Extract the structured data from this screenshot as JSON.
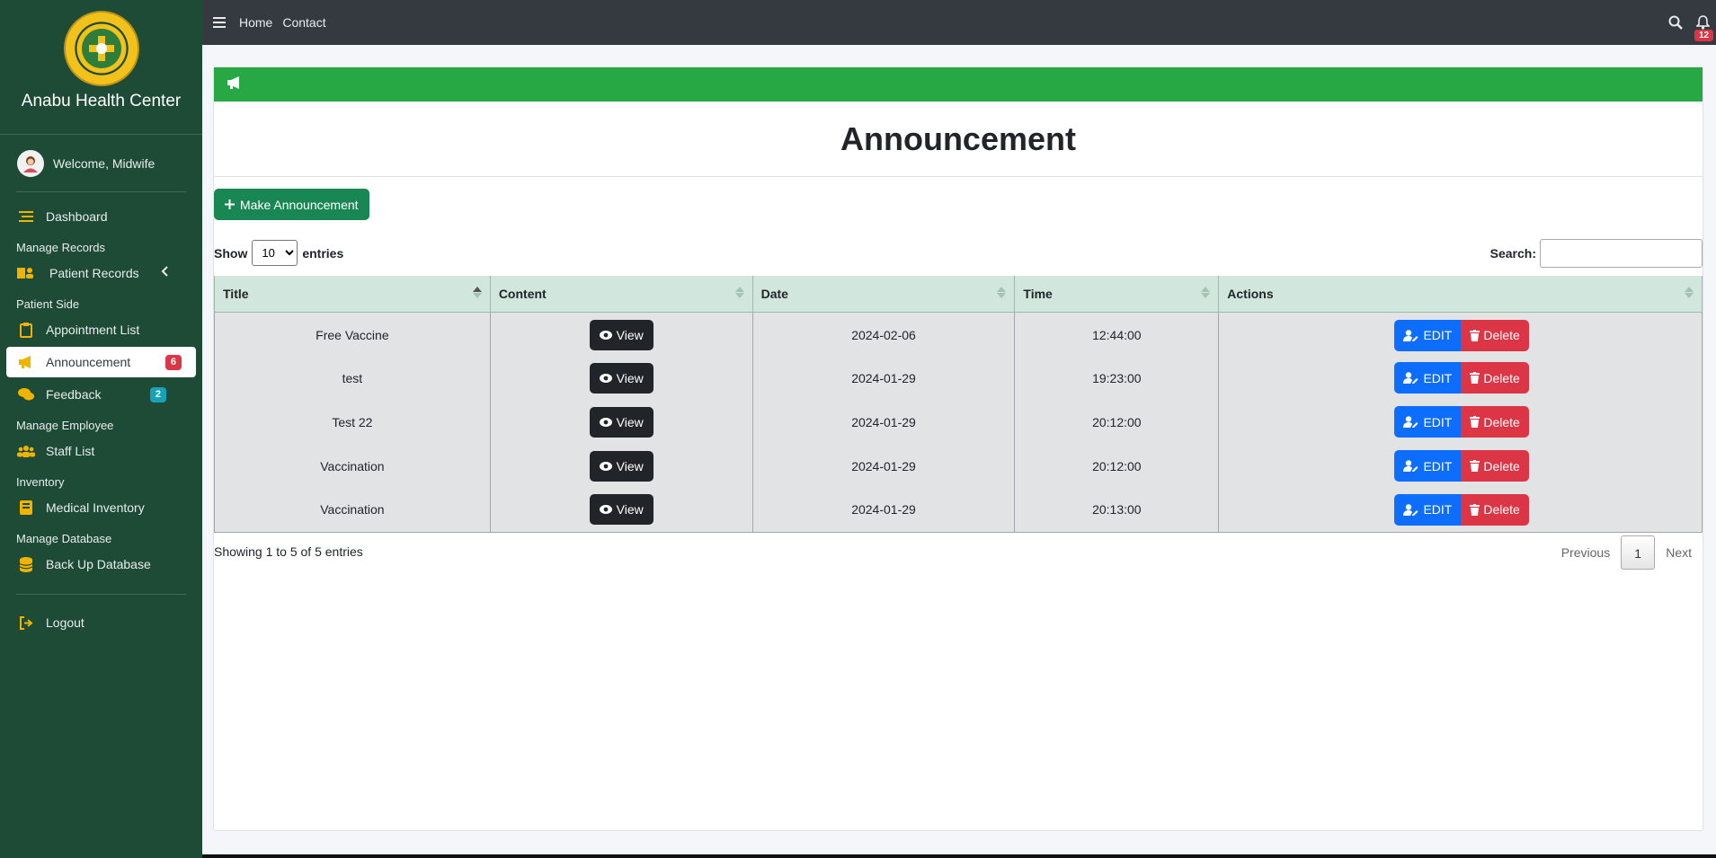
{
  "sidebar": {
    "brand": "Anabu Health Center",
    "logo_text": "ANABU II F HEALTH CENTER",
    "welcome": "Welcome, Midwife",
    "nav": [
      {
        "type": "item",
        "label": "Dashboard",
        "icon": "bars-icon"
      },
      {
        "type": "head",
        "label": "Manage Records"
      },
      {
        "type": "item",
        "label": "Patient Records",
        "icon": "patient-records-icon",
        "chevron": true
      },
      {
        "type": "head",
        "label": "Patient Side"
      },
      {
        "type": "item",
        "label": "Appointment List",
        "icon": "clipboard-icon"
      },
      {
        "type": "item",
        "label": "Announcement",
        "icon": "bullhorn-icon",
        "active": true,
        "badge": "6",
        "badge_color": "red"
      },
      {
        "type": "item",
        "label": "Feedback",
        "icon": "comments-icon",
        "badge": "2",
        "badge_color": "teal"
      },
      {
        "type": "head",
        "label": "Manage Employee"
      },
      {
        "type": "item",
        "label": "Staff List",
        "icon": "users-icon"
      },
      {
        "type": "head",
        "label": "Inventory"
      },
      {
        "type": "item",
        "label": "Medical Inventory",
        "icon": "book-icon"
      },
      {
        "type": "head",
        "label": "Manage Database"
      },
      {
        "type": "item",
        "label": "Back Up Database",
        "icon": "database-icon"
      }
    ],
    "logout": "Logout"
  },
  "topbar": {
    "links": [
      "Home",
      "Contact"
    ],
    "notification_count": "12"
  },
  "page": {
    "title": "Announcement",
    "make_button": "Make Announcement",
    "show_label": "Show",
    "entries_label": "entries",
    "page_length": "10",
    "search_label": "Search:",
    "search_value": "",
    "columns": [
      "Title",
      "Content",
      "Date",
      "Time",
      "Actions"
    ],
    "rows": [
      {
        "title": "Free Vaccine",
        "date": "2024-02-06",
        "time": "12:44:00"
      },
      {
        "title": "test",
        "date": "2024-01-29",
        "time": "19:23:00"
      },
      {
        "title": "Test 22",
        "date": "2024-01-29",
        "time": "20:12:00"
      },
      {
        "title": "Vaccination",
        "date": "2024-01-29",
        "time": "20:12:00"
      },
      {
        "title": "Vaccination",
        "date": "2024-01-29",
        "time": "20:13:00"
      }
    ],
    "view_label": "View",
    "edit_label": "EDIT",
    "delete_label": "Delete",
    "info": "Showing 1 to 5 of 5 entries",
    "pager": {
      "previous": "Previous",
      "current": "1",
      "next": "Next"
    }
  },
  "colors": {
    "sidebar_bg": "#1d4b36",
    "accent_yellow": "#f0b400",
    "header_green": "#28a745",
    "make_btn": "#198754",
    "edit_btn": "#0d6efd",
    "delete_btn": "#dc3545",
    "view_btn": "#212529"
  }
}
